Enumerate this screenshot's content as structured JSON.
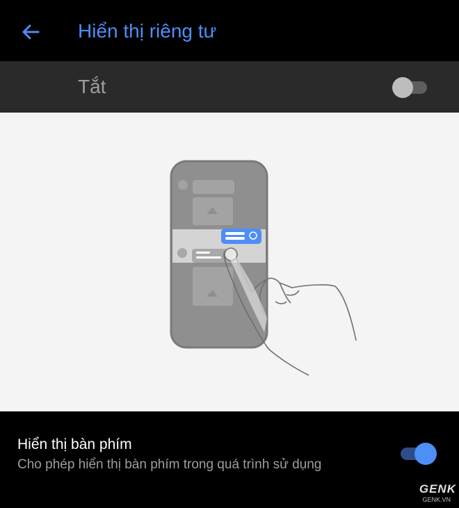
{
  "header": {
    "back_icon": "arrow-left-icon",
    "title": "Hiển thị riêng tư"
  },
  "master_switch": {
    "label": "Tắt",
    "state": "off"
  },
  "illustration": {
    "icon": "phone-privacy-illustration"
  },
  "setting": {
    "title": "Hiển thị bàn phím",
    "description": "Cho phép hiển thị bàn phím trong quá trình sử dụng",
    "state": "on"
  },
  "watermark": {
    "brand": "GENK",
    "site": "GENK.VN"
  },
  "colors": {
    "accent": "#4d8ef7",
    "background": "#000000",
    "bar": "#2a2a2a",
    "panel": "#f4f4f4"
  }
}
